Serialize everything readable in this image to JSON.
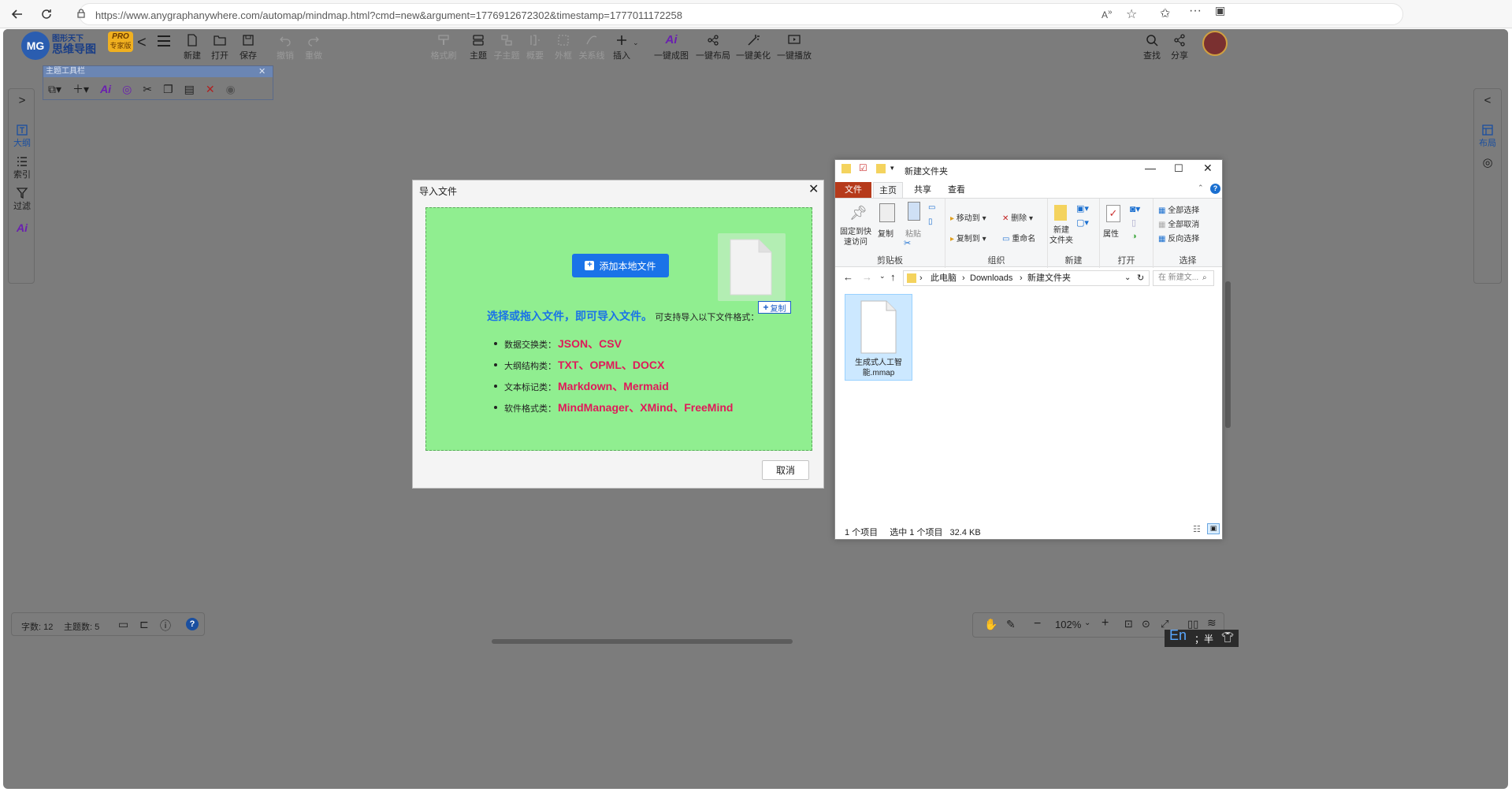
{
  "browser": {
    "url": "https://www.anygraphanywhere.com/automap/mindmap.html?cmd=new&argument=1776912672302&timestamp=1777011172258"
  },
  "app": {
    "logo_line1": "图形天下",
    "logo_line2": "思维导图",
    "pro_badge": "PRO",
    "pro_sub": "专家版",
    "toolbar": {
      "new": "新建",
      "open": "打开",
      "save": "保存",
      "undo": "撤销",
      "redo": "重做",
      "format_brush": "格式刷",
      "topic": "主题",
      "subtopic": "子主题",
      "summary": "概要",
      "boundary": "外框",
      "relation": "关系线",
      "insert": "插入",
      "ai_map": "一键成图",
      "ai_layout": "一键布局",
      "ai_beautify": "一键美化",
      "ai_play": "一键播放",
      "find": "查找",
      "share": "分享"
    },
    "left_panel": {
      "outline": "大纲",
      "index": "索引",
      "filter": "过滤"
    },
    "right_panel": {
      "layout": "布局"
    },
    "topic_toolbar_title": "主题工具栏",
    "status_left": {
      "word_count": "字数: 12",
      "topic_count": "主题数: 5"
    },
    "zoom": "102%"
  },
  "dialog": {
    "title": "导入文件",
    "add_button": "添加本地文件",
    "copy_tag": "复制",
    "headline": "选择或拖入文件，即可导入文件。",
    "subline": "可支持导入以下文件格式：",
    "formats": [
      {
        "label": "数据交换类：",
        "value": "JSON、CSV"
      },
      {
        "label": "大纲结构类：",
        "value": "TXT、OPML、DOCX"
      },
      {
        "label": "文本标记类：",
        "value": "Markdown、Mermaid"
      },
      {
        "label": "软件格式类：",
        "value": "MindManager、XMind、FreeMind"
      }
    ],
    "cancel": "取消"
  },
  "explorer": {
    "title": "新建文件夹",
    "tabs": [
      "文件",
      "主页",
      "共享",
      "查看"
    ],
    "ribbon": {
      "pin": "固定到快\n速访问",
      "copy": "复制",
      "paste": "粘贴",
      "clipboard": "剪贴板",
      "move_to": "移动到",
      "copy_to": "复制到",
      "delete": "删除",
      "rename": "重命名",
      "organize": "组织",
      "new_folder": "新建\n文件夹",
      "new": "新建",
      "properties": "属性",
      "open": "打开",
      "select_all": "全部选择",
      "select_none": "全部取消",
      "invert": "反向选择",
      "select": "选择"
    },
    "breadcrumb": [
      "此电脑",
      "Downloads",
      "新建文件夹"
    ],
    "search_placeholder": "在 新建文...",
    "file_name": "生成式人工智能.mmap",
    "status_items": "1 个项目",
    "status_selected": "选中 1 个项目",
    "status_size": "32.4 KB"
  },
  "ime": {
    "lang": "En",
    "mode": "；半"
  }
}
